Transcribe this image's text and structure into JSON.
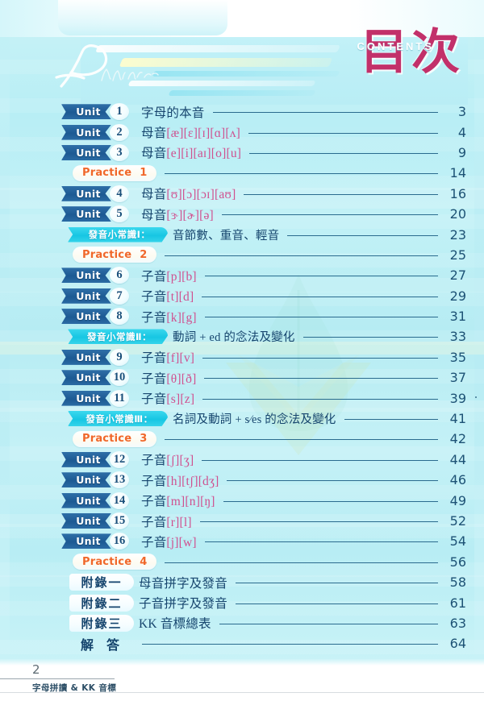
{
  "header": {
    "logo_script": "Phonics",
    "title_cn": "目次",
    "title_en": "CONTENTS"
  },
  "labels": {
    "unit": "Unit",
    "practice": "Practice"
  },
  "toc": {
    "rows": [
      {
        "kind": "unit",
        "badge": "Unit",
        "num": "1",
        "text_html": "字母的本音",
        "page": "3"
      },
      {
        "kind": "unit",
        "badge": "Unit",
        "num": "2",
        "text_html": "母音<b>[æ]</b><b>[ɛ]</b><b>[ɪ]</b><b>[ɑ]</b><b>[ʌ]</b>",
        "page": "4"
      },
      {
        "kind": "unit",
        "badge": "Unit",
        "num": "3",
        "text_html": "母音<b>[e]</b><b>[i]</b><b>[aɪ]</b><b>[o]</b><b>[u]</b>",
        "page": "9"
      },
      {
        "kind": "practice",
        "badge": "Practice",
        "num": "1",
        "text_html": "",
        "page": "14"
      },
      {
        "kind": "unit",
        "badge": "Unit",
        "num": "4",
        "text_html": "母音<b>[ʊ]</b><b>[ɔ]</b><b>[ɔɪ]</b><b>[aʊ]</b>",
        "page": "16"
      },
      {
        "kind": "unit",
        "badge": "Unit",
        "num": "5",
        "text_html": "母音<b>[ɝ]</b><b>[ɚ]</b><b>[ə]</b>",
        "page": "20"
      },
      {
        "kind": "tip",
        "badge": "發音小常識Ⅰ：",
        "num": "",
        "text_html": "音節數、重音、輕音",
        "page": "23"
      },
      {
        "kind": "practice",
        "badge": "Practice",
        "num": "2",
        "text_html": "",
        "page": "25"
      },
      {
        "kind": "unit",
        "badge": "Unit",
        "num": "6",
        "text_html": "子音<b>[p]</b><b>[b]</b>",
        "page": "27"
      },
      {
        "kind": "unit",
        "badge": "Unit",
        "num": "7",
        "text_html": "子音<b>[t]</b><b>[d]</b>",
        "page": "29"
      },
      {
        "kind": "unit",
        "badge": "Unit",
        "num": "8",
        "text_html": "子音<b>[k]</b><b>[g]</b>",
        "page": "31"
      },
      {
        "kind": "tip",
        "badge": "發音小常識Ⅱ：",
        "num": "",
        "text_html": "動詞 + ed 的念法及變化",
        "page": "33"
      },
      {
        "kind": "unit",
        "badge": "Unit",
        "num": "9",
        "text_html": "子音<b>[f]</b><b>[v]</b>",
        "page": "35"
      },
      {
        "kind": "unit",
        "badge": "Unit",
        "num": "10",
        "text_html": "子音<b>[θ]</b><b>[ð]</b>",
        "page": "37"
      },
      {
        "kind": "unit",
        "badge": "Unit",
        "num": "11",
        "text_html": "子音<b>[s]</b><b>[z]</b>",
        "page": "39"
      },
      {
        "kind": "tip",
        "badge": "發音小常識Ⅲ：",
        "num": "",
        "text_html": "名詞及動詞 + s∕es 的念法及變化",
        "page": "41"
      },
      {
        "kind": "practice",
        "badge": "Practice",
        "num": "3",
        "text_html": "",
        "page": "42"
      },
      {
        "kind": "unit",
        "badge": "Unit",
        "num": "12",
        "text_html": "子音<b>[ʃ]</b><b>[ʒ]</b>",
        "page": "44"
      },
      {
        "kind": "unit",
        "badge": "Unit",
        "num": "13",
        "text_html": "子音<b>[h]</b><b>[tʃ]</b><b>[dʒ]</b>",
        "page": "46"
      },
      {
        "kind": "unit",
        "badge": "Unit",
        "num": "14",
        "text_html": "子音<b>[m]</b><b>[n]</b><b>[ŋ]</b>",
        "page": "49"
      },
      {
        "kind": "unit",
        "badge": "Unit",
        "num": "15",
        "text_html": "子音<b>[r]</b><b>[l]</b>",
        "page": "52"
      },
      {
        "kind": "unit",
        "badge": "Unit",
        "num": "16",
        "text_html": "子音<b>[j]</b><b>[w]</b>",
        "page": "54"
      },
      {
        "kind": "practice",
        "badge": "Practice",
        "num": "4",
        "text_html": "",
        "page": "56"
      },
      {
        "kind": "appendix",
        "badge": "附錄一",
        "num": "",
        "text_html": "母音拼字及發音",
        "page": "58"
      },
      {
        "kind": "appendix",
        "badge": "附錄二",
        "num": "",
        "text_html": "子音拼字及發音",
        "page": "61"
      },
      {
        "kind": "appendix",
        "badge": "附錄三",
        "num": "",
        "text_html": "KK 音標總表",
        "page": "63"
      },
      {
        "kind": "answer",
        "badge": "解 答",
        "num": "",
        "text_html": "",
        "page": "64"
      }
    ]
  },
  "footer": {
    "page_number": "2",
    "book_title": "字母拼讀 & KK 音標"
  },
  "colors": {
    "page_bg": "#b8eef5",
    "unit_badge": "#1d5a93",
    "practice_text": "#f0672a",
    "tip_badge": "#17c6e3",
    "title": "#c2306a",
    "entry_text": "#16456e",
    "phonetic": "#d0508f",
    "leader": "#2a6b8e"
  }
}
